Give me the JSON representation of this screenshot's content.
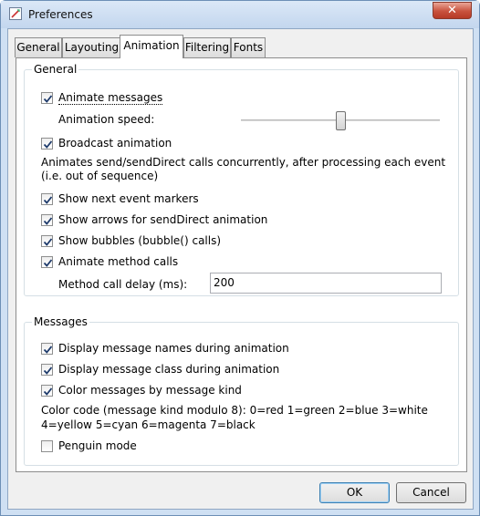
{
  "window": {
    "title": "Preferences",
    "close_glyph": "✕"
  },
  "tabs": [
    {
      "label": "General"
    },
    {
      "label": "Layouting"
    },
    {
      "label": "Animation"
    },
    {
      "label": "Filtering"
    },
    {
      "label": "Fonts"
    }
  ],
  "active_tab": "Animation",
  "general": {
    "title": "General",
    "animate_messages": {
      "label": "Animate messages",
      "checked": true
    },
    "animation_speed": {
      "label": "Animation speed:",
      "level": 0.5
    },
    "broadcast_animation": {
      "label": "Broadcast animation",
      "checked": true
    },
    "description_line1": "Animates send/sendDirect calls concurrently, after processing each event",
    "description_line2": "(i.e. out of sequence)",
    "show_next_event_markers": {
      "label": "Show next event markers",
      "checked": true
    },
    "show_arrows": {
      "label": "Show arrows for sendDirect animation",
      "checked": true
    },
    "show_bubbles": {
      "label": "Show bubbles (bubble() calls)",
      "checked": true
    },
    "animate_method_calls": {
      "label": "Animate method calls",
      "checked": true
    },
    "method_call_delay": {
      "label": "Method call delay (ms):",
      "value": "200"
    }
  },
  "messages": {
    "title": "Messages",
    "display_names": {
      "label": "Display message names during animation",
      "checked": true
    },
    "display_class": {
      "label": "Display message class during animation",
      "checked": true
    },
    "color_by_kind": {
      "label": "Color messages by message kind",
      "checked": true
    },
    "color_code_line1": "Color code (message kind modulo 8): 0=red 1=green 2=blue 3=white",
    "color_code_line2": "4=yellow 5=cyan 6=magenta 7=black",
    "penguin_mode": {
      "label": "Penguin mode",
      "checked": false
    }
  },
  "buttons": {
    "ok": "OK",
    "cancel": "Cancel"
  },
  "colors": {
    "accent": "#3c7fb1",
    "check": "#1d3a6b"
  }
}
